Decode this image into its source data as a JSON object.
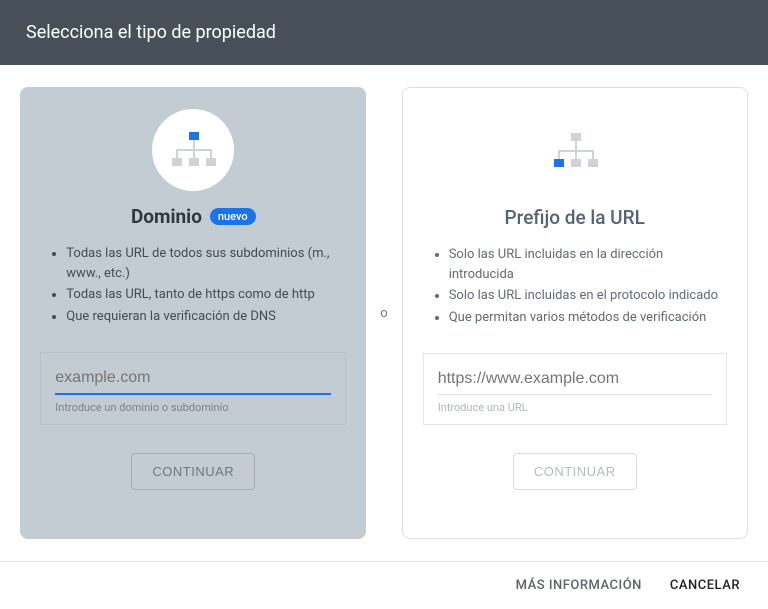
{
  "header": {
    "title": "Selecciona el tipo de propiedad"
  },
  "separator": "o",
  "cards": {
    "domain": {
      "title": "Dominio",
      "badge": "nuevo",
      "bullets": [
        "Todas las URL de todos sus subdominios (m., www., etc.)",
        "Todas las URL, tanto de https como de http",
        "Que requieran la verificación de DNS"
      ],
      "input_placeholder": "example.com",
      "input_helper": "Introduce un dominio o subdominio",
      "button": "CONTINUAR"
    },
    "url_prefix": {
      "title": "Prefijo de la URL",
      "bullets": [
        "Solo las URL incluidas en la dirección introducida",
        "Solo las URL incluidas en el protocolo indicado",
        "Que permitan varios métodos de verificación"
      ],
      "input_placeholder": "https://www.example.com",
      "input_helper": "Introduce una URL",
      "button": "CONTINUAR"
    }
  },
  "footer": {
    "more_info": "MÁS INFORMACIÓN",
    "cancel": "CANCELAR"
  }
}
